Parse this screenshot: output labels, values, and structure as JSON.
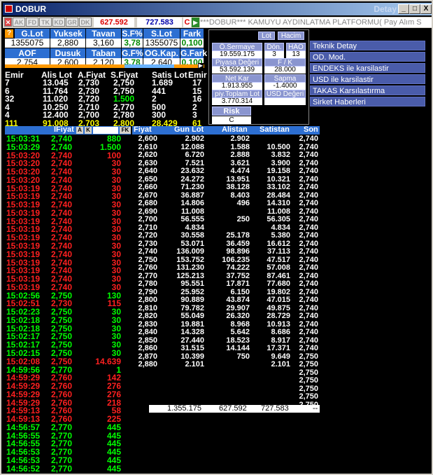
{
  "window": {
    "title": "DOBUR",
    "title_right": "Detay",
    "min": "_",
    "max": "□",
    "close": "X"
  },
  "toolbar": {
    "tags": [
      "AK",
      "FD",
      "TK",
      "KD",
      "GR",
      "DK"
    ],
    "value1": "627.592",
    "value2": "727.583",
    "c_label": "C",
    "ticker": "***DOBUR*** KAMUYU AYDINLATMA PLATFORMU( Pay Alım S"
  },
  "summary": {
    "row1_headers": [
      "G.Lot",
      "Yuksek",
      "Tavan",
      "S.F%",
      "S.Lot",
      "Fark"
    ],
    "row1_values": [
      "1355075",
      "2,880",
      "3,160",
      "3,78",
      "1355075",
      "0,100"
    ],
    "row2_headers": [
      "AOF",
      "Dusuk",
      "Taban",
      "G.F%",
      "OG.Kap.",
      "G.Fark"
    ],
    "row2_values": [
      "2,754",
      "2,600",
      "2,120",
      "3,78",
      "2,640",
      "0,100"
    ]
  },
  "popup": {
    "lot": "Lot",
    "hacim": "Hacim",
    "labels": [
      "Ö.Sermaye",
      "Dön.",
      "HAO",
      "Piyasa Değeri",
      "F / K",
      "Net Kar",
      "Sapma",
      "piy.Toplam Lot",
      "USD Değeri",
      "Risk Kodu"
    ],
    "values": [
      "19.559.175",
      "3",
      "13",
      "53.592.139",
      "28.000",
      "1.913.955",
      "-1.4000",
      "3.770.314",
      "",
      "C"
    ]
  },
  "menu": [
    "Teknik Detay",
    "OD. Mod.",
    "ENDEKS ile karsilastir",
    "USD ile karsilastir",
    "TAKAS Karsılastırma",
    "Sirket Haberleri"
  ],
  "depth": {
    "headers": [
      "Emir",
      "Alis Lot",
      "A.Fiyat",
      "S.Fiyat",
      "Satis Lot",
      "Emir"
    ],
    "rows": [
      [
        "7",
        "13.045",
        "2,730",
        "2,750",
        "1.689",
        "17"
      ],
      [
        "6",
        "11.764",
        "2,730",
        "2,750",
        "441",
        "15"
      ],
      [
        "32",
        "11.020",
        "2,720",
        "1.500",
        "2",
        "16"
      ],
      [
        "4",
        "10.250",
        "2,710",
        "2,770",
        "500",
        "2"
      ],
      [
        "4",
        "12.400",
        "2,700",
        "2,780",
        "300",
        "3"
      ],
      [
        "111",
        "91.008",
        "2,703",
        "2,800",
        "28.429",
        "61"
      ]
    ]
  },
  "trades": {
    "headers": [
      "lFiyat",
      "A",
      "K",
      "FK"
    ],
    "rows": [
      [
        "15:03:31",
        "2,740",
        "880",
        "g"
      ],
      [
        "15:03:29",
        "2,740",
        "1.500",
        "g"
      ],
      [
        "15:03:20",
        "2,740",
        "100",
        "r"
      ],
      [
        "15:03:20",
        "2,740",
        "30",
        "r"
      ],
      [
        "15:03:20",
        "2,740",
        "30",
        "r"
      ],
      [
        "15:03:20",
        "2,740",
        "30",
        "r"
      ],
      [
        "15:03:19",
        "2,740",
        "30",
        "r"
      ],
      [
        "15:03:19",
        "2,740",
        "30",
        "r"
      ],
      [
        "15:03:19",
        "2,740",
        "30",
        "r"
      ],
      [
        "15:03:19",
        "2,740",
        "30",
        "r"
      ],
      [
        "15:03:19",
        "2,740",
        "30",
        "r"
      ],
      [
        "15:03:19",
        "2,740",
        "30",
        "r"
      ],
      [
        "15:03:19",
        "2,740",
        "30",
        "r"
      ],
      [
        "15:03:19",
        "2,740",
        "30",
        "r"
      ],
      [
        "15:03:19",
        "2,740",
        "30",
        "r"
      ],
      [
        "15:03:19",
        "2,740",
        "30",
        "r"
      ],
      [
        "15:03:19",
        "2,740",
        "30",
        "r"
      ],
      [
        "15:03:19",
        "2,740",
        "30",
        "r"
      ],
      [
        "15:03:19",
        "2,740",
        "30",
        "r"
      ],
      [
        "15:02:56",
        "2,750",
        "130",
        "g"
      ],
      [
        "15:02:51",
        "2,730",
        "115",
        "r"
      ],
      [
        "15:02:23",
        "2,750",
        "30",
        "g"
      ],
      [
        "15:02:18",
        "2,750",
        "30",
        "g"
      ],
      [
        "15:02:18",
        "2,750",
        "30",
        "g"
      ],
      [
        "15:02:17",
        "2,750",
        "30",
        "g"
      ],
      [
        "15:02:17",
        "2,750",
        "30",
        "g"
      ],
      [
        "15:02:15",
        "2,750",
        "30",
        "g"
      ],
      [
        "15:02:08",
        "2,750",
        "14.639",
        "r"
      ],
      [
        "14:59:56",
        "2,770",
        "1",
        "g"
      ],
      [
        "14:59:29",
        "2,760",
        "142",
        "r"
      ],
      [
        "14:59:29",
        "2,760",
        "276",
        "r"
      ],
      [
        "14:59:29",
        "2,760",
        "276",
        "r"
      ],
      [
        "14:59:29",
        "2,760",
        "218",
        "r"
      ],
      [
        "14:59:13",
        "2,760",
        "58",
        "r"
      ],
      [
        "14:59:13",
        "2,760",
        "225",
        "r"
      ],
      [
        "14:56:57",
        "2,770",
        "445",
        "g"
      ],
      [
        "14:56:55",
        "2,770",
        "445",
        "g"
      ],
      [
        "14:56:55",
        "2,770",
        "445",
        "g"
      ],
      [
        "14:56:53",
        "2,770",
        "445",
        "g"
      ],
      [
        "14:56:53",
        "2,770",
        "445",
        "g"
      ],
      [
        "14:56:52",
        "2,770",
        "445",
        "g"
      ]
    ]
  },
  "session": {
    "headers": [
      "Fiyat",
      "Gun Lot",
      "Alistan",
      "Satistan",
      "Son"
    ],
    "rows": [
      [
        "2,600",
        "2.902",
        "2.902",
        "",
        "2,740"
      ],
      [
        "2,610",
        "12.088",
        "1.588",
        "10.500",
        "2,740"
      ],
      [
        "2,620",
        "6.720",
        "2.888",
        "3.832",
        "2,740"
      ],
      [
        "2,630",
        "7.521",
        "3.621",
        "3.900",
        "2,740"
      ],
      [
        "2,640",
        "23.632",
        "4.474",
        "19.158",
        "2,740"
      ],
      [
        "2,650",
        "24.272",
        "13.951",
        "10.321",
        "2,740"
      ],
      [
        "2,660",
        "71.230",
        "38.128",
        "33.102",
        "2,740"
      ],
      [
        "2,670",
        "36.887",
        "8.403",
        "28.484",
        "2,740"
      ],
      [
        "2,680",
        "14.806",
        "496",
        "14.310",
        "2,740"
      ],
      [
        "2,690",
        "11.008",
        "",
        "11.008",
        "2,740"
      ],
      [
        "2,700",
        "56.555",
        "250",
        "56.305",
        "2,740"
      ],
      [
        "2,710",
        "4.834",
        "",
        "4.834",
        "2,740"
      ],
      [
        "2,720",
        "30.558",
        "25.178",
        "5.380",
        "2,740"
      ],
      [
        "2,730",
        "53.071",
        "36.459",
        "16.612",
        "2,740"
      ],
      [
        "2,740",
        "136.009",
        "98.896",
        "37.113",
        "2,740"
      ],
      [
        "2,750",
        "153.752",
        "106.235",
        "47.517",
        "2,740"
      ],
      [
        "2,760",
        "131.230",
        "74.222",
        "57.008",
        "2,740"
      ],
      [
        "2,770",
        "125.213",
        "37.752",
        "87.461",
        "2,740"
      ],
      [
        "2,780",
        "95.551",
        "17.871",
        "77.680",
        "2,740"
      ],
      [
        "2,790",
        "25.952",
        "6.150",
        "19.802",
        "2,740"
      ],
      [
        "2,800",
        "90.889",
        "43.874",
        "47.015",
        "2,740"
      ],
      [
        "2,810",
        "79.782",
        "29.907",
        "49.875",
        "2,740"
      ],
      [
        "2,820",
        "55.049",
        "26.320",
        "28.729",
        "2,740"
      ],
      [
        "2,830",
        "19.881",
        "8.968",
        "10.913",
        "2,740"
      ],
      [
        "2,840",
        "14.328",
        "5.642",
        "8.686",
        "2,740"
      ],
      [
        "2,850",
        "27.440",
        "18.523",
        "8.917",
        "2,740"
      ],
      [
        "2,860",
        "31.515",
        "14.144",
        "17.371",
        "2,740"
      ],
      [
        "2,870",
        "10.399",
        "750",
        "9.649",
        "2,750"
      ],
      [
        "2,880",
        "2.101",
        "",
        "2.101",
        "2,750"
      ]
    ],
    "extra_son": [
      "2,750",
      "2,750",
      "2,750",
      "2,750",
      "2,750"
    ],
    "totals": [
      "1.355.175",
      "627.592",
      "727.583",
      "--"
    ]
  }
}
